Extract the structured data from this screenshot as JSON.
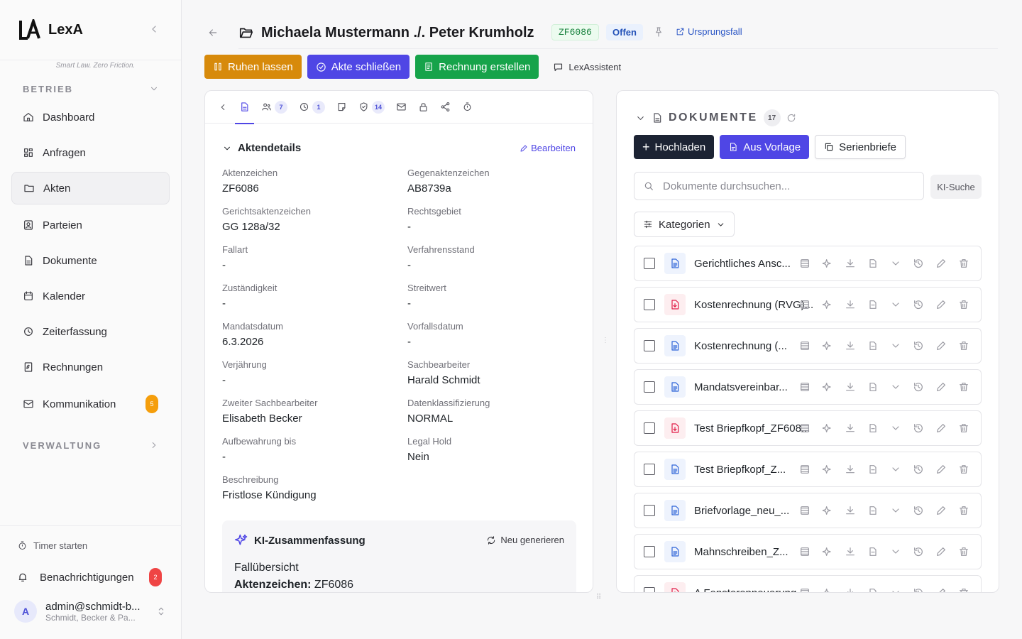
{
  "app": {
    "name": "LexA",
    "tagline": "Smart Law. Zero Friction."
  },
  "sidebar": {
    "section_betrieb": "BETRIEB",
    "section_verwaltung": "VERWALTUNG",
    "items": [
      {
        "label": "Dashboard",
        "icon": "home-icon"
      },
      {
        "label": "Anfragen",
        "icon": "grid-icon"
      },
      {
        "label": "Akten",
        "icon": "folder-icon"
      },
      {
        "label": "Parteien",
        "icon": "contact-icon"
      },
      {
        "label": "Dokumente",
        "icon": "file-icon"
      },
      {
        "label": "Kalender",
        "icon": "calendar-icon"
      },
      {
        "label": "Zeiterfassung",
        "icon": "clock-icon"
      },
      {
        "label": "Rechnungen",
        "icon": "invoice-icon"
      },
      {
        "label": "Kommunikation",
        "icon": "mail-icon",
        "badge": "5"
      }
    ],
    "timer": "Timer starten",
    "notifications": {
      "label": "Benachrichtigungen",
      "badge": "2"
    },
    "user": {
      "initial": "A",
      "email": "admin@schmidt-b...",
      "org": "Schmidt, Becker & Pa..."
    }
  },
  "header": {
    "title": "Michaela Mustermann ./. Peter Krumholz",
    "code": "ZF6086",
    "status": "Offen",
    "origin_link": "Ursprungsfall"
  },
  "actions": {
    "pause": "Ruhen lassen",
    "close": "Akte schließen",
    "invoice": "Rechnung erstellen",
    "assistant": "LexAssistent"
  },
  "tabs": {
    "parties_badge": "7",
    "time_badge": "1",
    "security_badge": "14"
  },
  "details": {
    "heading": "Aktendetails",
    "edit": "Bearbeiten",
    "fields": [
      {
        "label": "Aktenzeichen",
        "value": "ZF6086"
      },
      {
        "label": "Gegenaktenzeichen",
        "value": "AB8739a"
      },
      {
        "label": "Gerichtsaktenzeichen",
        "value": "GG 128a/32"
      },
      {
        "label": "Rechtsgebiet",
        "value": "-"
      },
      {
        "label": "Fallart",
        "value": "-"
      },
      {
        "label": "Verfahrensstand",
        "value": "-"
      },
      {
        "label": "Zuständigkeit",
        "value": "-"
      },
      {
        "label": "Streitwert",
        "value": "-"
      },
      {
        "label": "Mandatsdatum",
        "value": "6.3.2026"
      },
      {
        "label": "Vorfallsdatum",
        "value": "-"
      },
      {
        "label": "Verjährung",
        "value": "-"
      },
      {
        "label": "Sachbearbeiter",
        "value": "Harald Schmidt"
      },
      {
        "label": "Zweiter Sachbearbeiter",
        "value": "Elisabeth Becker"
      },
      {
        "label": "Datenklassifizierung",
        "value": "NORMAL"
      },
      {
        "label": "Aufbewahrung bis",
        "value": "-"
      },
      {
        "label": "Legal Hold",
        "value": "Nein"
      },
      {
        "label": "Beschreibung",
        "value": "Fristlose Kündigung"
      }
    ]
  },
  "ki": {
    "heading": "KI-Zusammenfassung",
    "regenerate": "Neu generieren",
    "line1": "Fallübersicht",
    "line2_label": "Aktenzeichen:",
    "line2_value": "ZF6086"
  },
  "documents": {
    "title": "DOKUMENTE",
    "count": "17",
    "upload": "Hochladen",
    "template": "Aus Vorlage",
    "serial": "Serienbriefe",
    "search_placeholder": "Dokumente durchsuchen...",
    "ki_search": "KI-Suche",
    "categories": "Kategorien",
    "items": [
      {
        "name": "Gerichtliches Ansc...",
        "type": "doc"
      },
      {
        "name": "Kostenrechnung (RVG)...",
        "type": "pdf"
      },
      {
        "name": "Kostenrechnung (...",
        "type": "doc"
      },
      {
        "name": "Mandatsvereinbar...",
        "type": "doc"
      },
      {
        "name": "Test Briepfkopf_ZF608...",
        "type": "pdf"
      },
      {
        "name": "Test Briepfkopf_Z...",
        "type": "doc"
      },
      {
        "name": "Briefvorlage_neu_...",
        "type": "doc"
      },
      {
        "name": "Mahnschreiben_Z...",
        "type": "doc"
      },
      {
        "name": "A Fensterenneuerung",
        "type": "pdf"
      }
    ]
  },
  "colors": {
    "accent": "#4f46e5",
    "orange": "#d78a0b",
    "green": "#16a34a",
    "dark": "#1c2333"
  }
}
